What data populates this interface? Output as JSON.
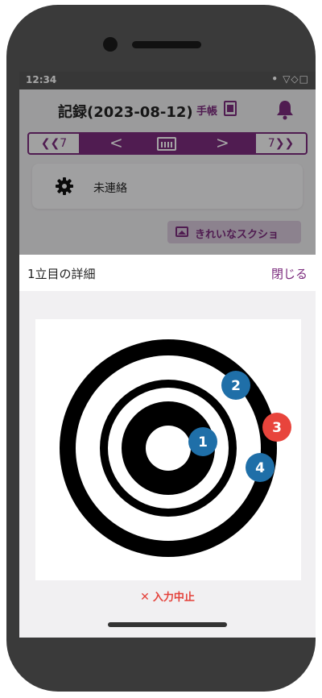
{
  "status_bar": {
    "time": "12:34",
    "icons": "• ▽◇□"
  },
  "header": {
    "title": "記録(2023-08-12)",
    "techo_label": "手帳"
  },
  "date_nav": {
    "prev_week_label": "7",
    "next_week_label": "7"
  },
  "status_card": {
    "label": "未連絡"
  },
  "screenshot_button": {
    "label": "きれいなスクショ"
  },
  "sheet": {
    "title": "1立目の詳細",
    "close_label": "閉じる",
    "abort_icon": "✕",
    "abort_label": "入力中止"
  },
  "hits": [
    {
      "label": "1",
      "color": "#1f6fa8"
    },
    {
      "label": "2",
      "color": "#1f6fa8"
    },
    {
      "label": "3",
      "color": "#e8443c"
    },
    {
      "label": "4",
      "color": "#1f6fa8"
    }
  ],
  "colors": {
    "accent": "#7b2b7d",
    "hit_blue": "#1f6fa8",
    "hit_red": "#e8443c",
    "abort_red": "#e4413a"
  }
}
